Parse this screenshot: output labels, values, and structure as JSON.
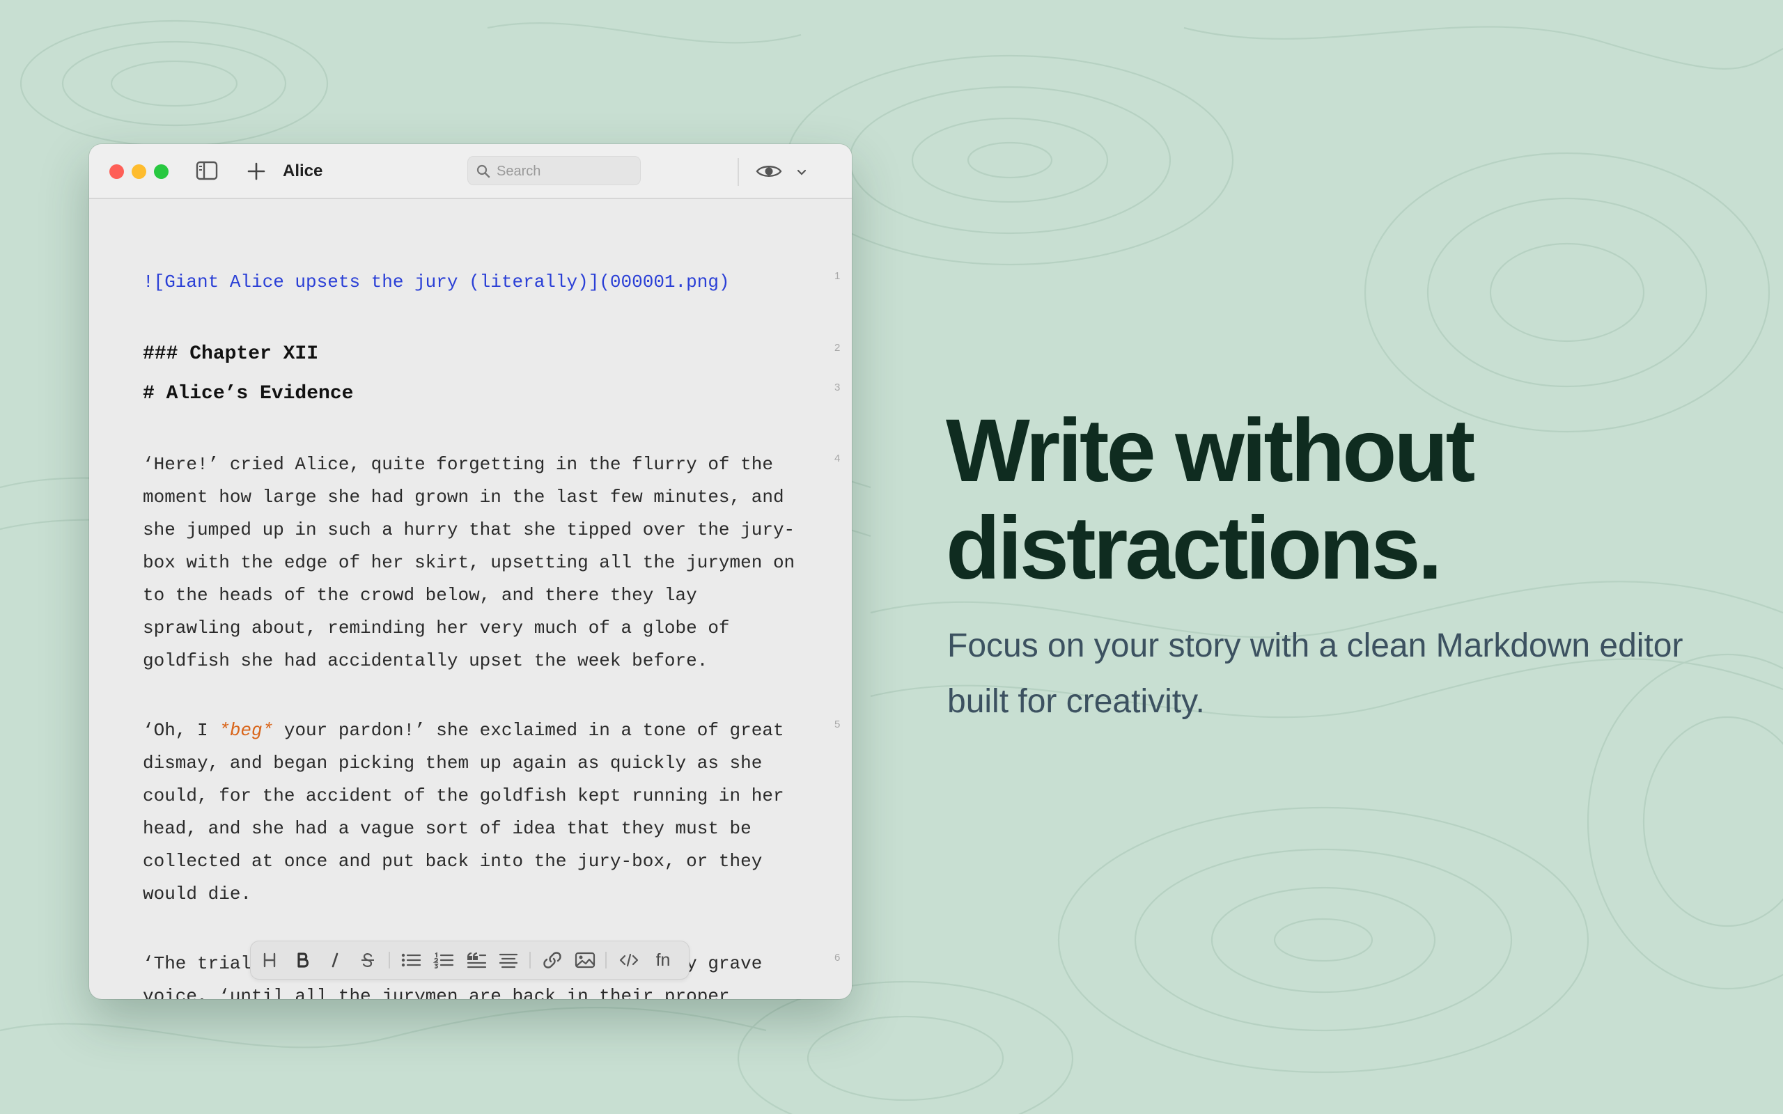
{
  "window": {
    "title": "Alice",
    "search_placeholder": "Search"
  },
  "editor": {
    "lines": [
      {
        "num": "1",
        "text": "![Giant Alice upsets the jury (literally)](000001.png)"
      },
      {
        "num": "2",
        "text": "### Chapter XII"
      },
      {
        "num": "3",
        "text": "# Alice’s Evidence"
      },
      {
        "num": "4",
        "text": "‘Here!’ cried Alice, quite forgetting in the flurry of the moment how large she had grown in the last few minutes, and she jumped up in such a hurry that she tipped over the jury-box with the edge of her skirt, upsetting all the jurymen on to the heads of the crowd below, and there they lay sprawling about, reminding her very much of a globe of goldfish she had accidentally upset the week before."
      },
      {
        "num": "5",
        "before": "‘Oh, I ",
        "emphasis": "*beg*",
        "after": " your pardon!’ she exclaimed in a tone of great dismay, and began picking them up again as quickly as she could, for the accident of the goldfish kept running in her head, and she had a vague sort of idea that they must be collected at once and put back into the jury-box, or they would die."
      },
      {
        "num": "6",
        "text": "‘The trial cannot proceed,’ said the King in a very grave voice, ‘until all the jurymen are back in their proper places"
      }
    ]
  },
  "format_toolbar": {
    "footnote_label": "fn"
  },
  "marketing": {
    "headline": "Write without distractions.",
    "subhead": "Focus on your story with a clean Markdown editor built for creativity."
  },
  "colors": {
    "background": "#c8dfd2",
    "headline": "#0f2c20",
    "link": "#2a3fd6",
    "emphasis": "#d9651a"
  }
}
